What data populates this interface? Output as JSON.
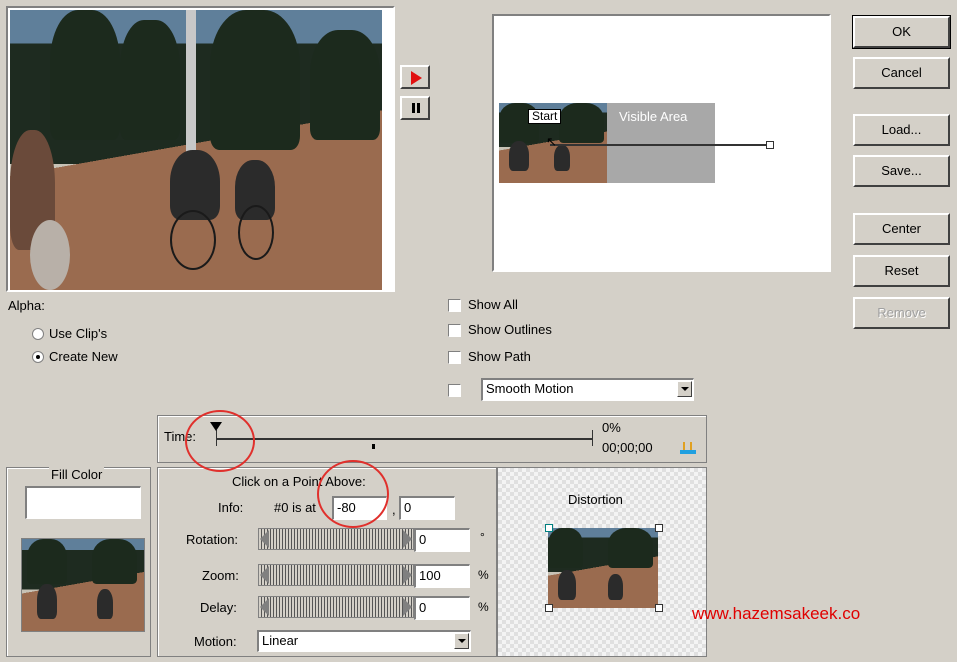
{
  "buttons": {
    "ok": "OK",
    "cancel": "Cancel",
    "load": "Load...",
    "save": "Save...",
    "center": "Center",
    "reset": "Reset",
    "remove": "Remove"
  },
  "preview": {
    "start_label": "Start",
    "visible_area_label": "Visible Area"
  },
  "alpha": {
    "label": "Alpha:",
    "options": [
      "Use Clip's",
      "Create New"
    ],
    "selected": "Create New"
  },
  "options": {
    "show_all": "Show All",
    "show_outlines": "Show Outlines",
    "show_path": "Show Path",
    "smooth_motion": "Smooth Motion"
  },
  "timeline": {
    "label": "Time:",
    "percent": "0%",
    "timecode": "00;00;00"
  },
  "fill_color": {
    "label": "Fill Color"
  },
  "point_panel": {
    "heading": "Click on a Point Above:",
    "info_label": "Info:",
    "info_text": "#0 is at",
    "info_x": "-80",
    "info_sep": ",",
    "info_y": "0",
    "rotation_label": "Rotation:",
    "rotation_value": "0",
    "rotation_unit": "°",
    "zoom_label": "Zoom:",
    "zoom_value": "100",
    "zoom_unit": "%",
    "delay_label": "Delay:",
    "delay_value": "0",
    "delay_unit": "%",
    "motion_label": "Motion:",
    "motion_value": "Linear"
  },
  "distortion": {
    "label": "Distortion"
  },
  "watermark": "www.hazemsakeek.co",
  "colors": {
    "dialog_bg": "#d4d0c8",
    "play_red": "#e01010",
    "annotation_red": "#e0302c",
    "watermark": "#e00000"
  }
}
